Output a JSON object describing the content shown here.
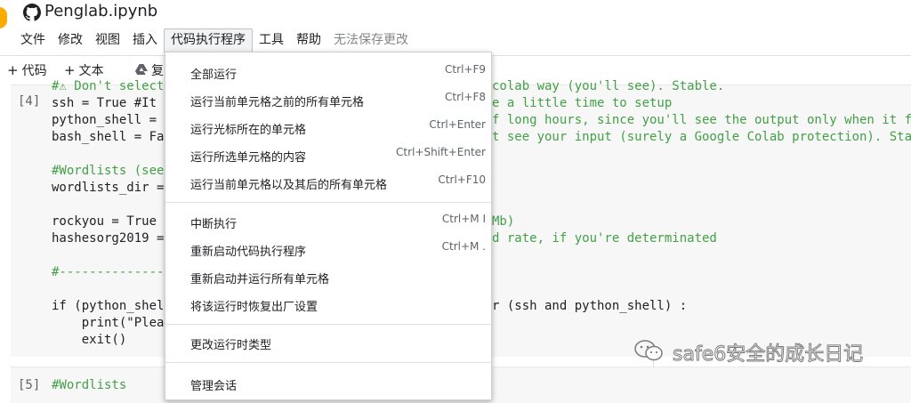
{
  "notebook": {
    "file_name": "Penglab.ipynb"
  },
  "menubar": {
    "items": [
      "文件",
      "修改",
      "视图",
      "插入",
      "代码执行程序",
      "工具",
      "帮助"
    ],
    "status": "无法保存更改"
  },
  "toolbar": {
    "add_code": "代码",
    "add_text": "文本",
    "copy_partial": "复"
  },
  "cells": [
    {
      "exec": "[4]",
      "lines": [
        "#⚠ Don't select",
        "ssh = True #It",
        "python_shell =",
        "bash_shell = Fa",
        "",
        "#Wordlists (see",
        "wordlists_dir =",
        "",
        "rockyou = True",
        "hashesorg2019 =",
        "",
        "#--------------",
        "",
        "if (python_shel",
        "    print(\"Plea",
        "    exit()"
      ],
      "right_lines": [
        "colab way (you'll see). Stable.",
        "e a little time to setup",
        "f long hours, since you'll see the output only when it fi",
        "t see your input (surely a Google Colab protection). Stab",
        "",
        "",
        "",
        "",
        "Mb)",
        "d rate, if you're determinated",
        "",
        "",
        "",
        "r (ssh and python_shell) :"
      ]
    },
    {
      "exec": "[5]",
      "lines": [
        "#Wordlists"
      ]
    }
  ],
  "runtime_menu": {
    "groups": [
      [
        {
          "label": "全部运行",
          "shortcut": "Ctrl+F9"
        },
        {
          "label": "运行当前单元格之前的所有单元格",
          "shortcut": "Ctrl+F8"
        },
        {
          "label": "运行光标所在的单元格",
          "shortcut": "Ctrl+Enter"
        },
        {
          "label": "运行所选单元格的内容",
          "shortcut": "Ctrl+Shift+Enter"
        },
        {
          "label": "运行当前单元格以及其后的所有单元格",
          "shortcut": "Ctrl+F10"
        }
      ],
      [
        {
          "label": "中断执行",
          "shortcut": "Ctrl+M I"
        },
        {
          "label": "重新启动代码执行程序",
          "shortcut": "Ctrl+M ."
        },
        {
          "label": "重新启动并运行所有单元格",
          "shortcut": ""
        },
        {
          "label": "将该运行时恢复出厂设置",
          "shortcut": ""
        }
      ],
      [
        {
          "label": "更改运行时类型",
          "shortcut": ""
        }
      ],
      [
        {
          "label": "管理会话",
          "shortcut": ""
        }
      ]
    ]
  },
  "watermark": {
    "text": "safe6安全的成长日记"
  },
  "colors": {
    "keyword": "#7c4dff",
    "comment": "#43a047",
    "string": "#a31515",
    "accent": "#f9ab00"
  }
}
